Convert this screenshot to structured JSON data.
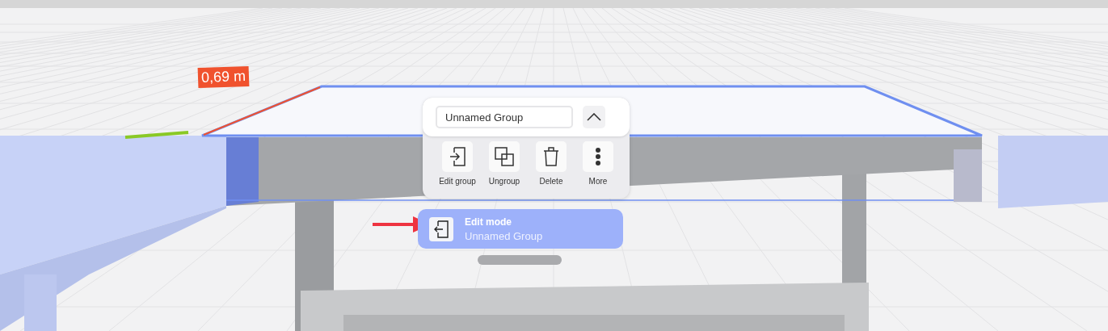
{
  "dimension_label": "0,69 m",
  "group_panel": {
    "name_field": {
      "value": "Unnamed Group"
    },
    "collapse_button": {
      "expanded": true
    },
    "actions": [
      {
        "kind": "edit",
        "label": "Edit group"
      },
      {
        "kind": "ungroup",
        "label": "Ungroup"
      },
      {
        "kind": "delete",
        "label": "Delete"
      },
      {
        "kind": "more",
        "label": "More"
      }
    ]
  },
  "mode_toast": {
    "title": "Edit mode",
    "subtitle": "Unnamed Group"
  }
}
